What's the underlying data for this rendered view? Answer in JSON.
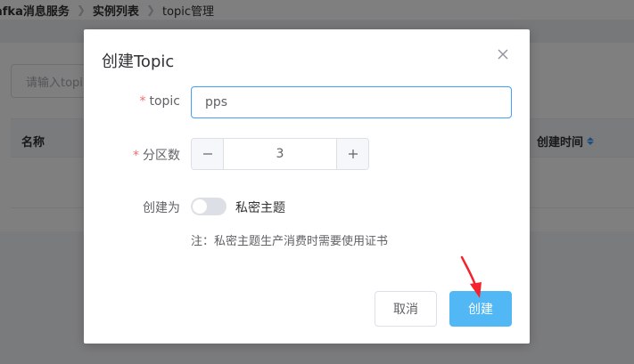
{
  "breadcrumb": {
    "items": [
      "afka消息服务",
      "实例列表",
      "topic管理"
    ]
  },
  "background": {
    "search_placeholder": "请输入topi",
    "columns": [
      "名称",
      "创建时间"
    ]
  },
  "dialog": {
    "title": "创建Topic",
    "close_icon": "close-icon",
    "topic": {
      "label": "topic",
      "value": "pps"
    },
    "partitions": {
      "label": "分区数",
      "value": "3"
    },
    "create_as": {
      "label": "创建为",
      "switch_label": "私密主题",
      "enabled": false
    },
    "note": "注：私密主题生产消费时需要使用证书",
    "cancel_label": "取消",
    "create_label": "创建"
  },
  "colors": {
    "primary": "#409eff",
    "create_button": "#52b8f5",
    "required": "#f56c6c",
    "annotation_arrow": "#f5222d"
  }
}
